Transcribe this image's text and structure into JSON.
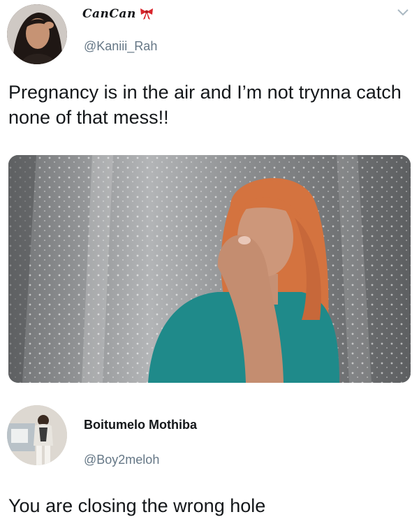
{
  "tweets": [
    {
      "display_name": "CanCan",
      "name_icon": "bow-icon",
      "handle": "@Kaniii_Rah",
      "text": "Pregnancy is in the air and I’m not trynna catch none of that mess!!",
      "has_media": true,
      "menu_icon": "chevron-down-icon"
    },
    {
      "display_name": "Boitumelo Mothiba",
      "handle": "@Boy2meloh",
      "text": "You are closing the wrong hole"
    }
  ],
  "colors": {
    "text": "#14171a",
    "secondary_text": "#657786",
    "bow": "#d9242b",
    "background": "#ffffff"
  }
}
